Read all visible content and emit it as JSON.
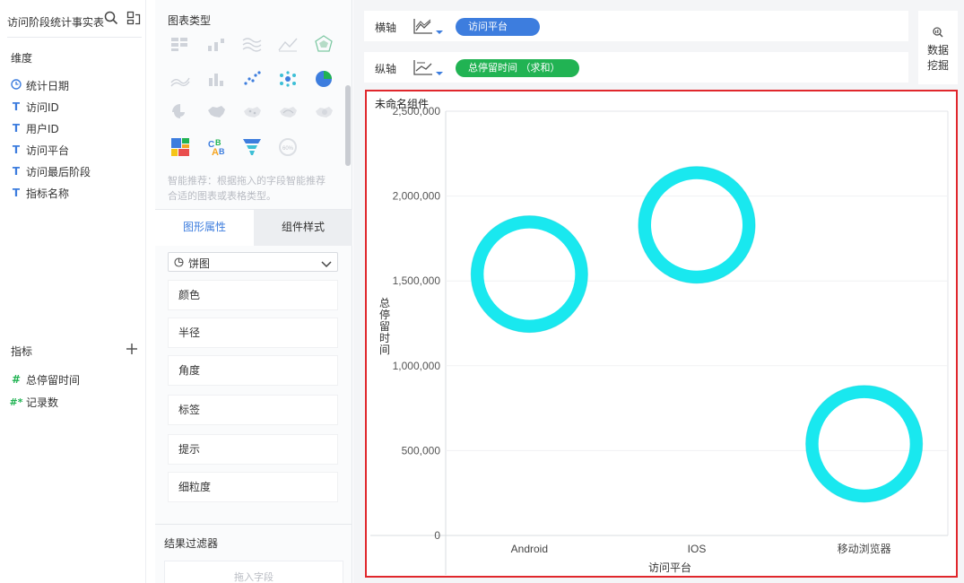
{
  "datasource": {
    "title": "访问阶段统计事实表",
    "search_icon": "search-icon",
    "switch_icon": "switch-dataset-icon"
  },
  "dimensions": {
    "label": "维度",
    "items": [
      {
        "icon": "clock-icon",
        "glyph": "◷",
        "label": "统计日期"
      },
      {
        "icon": "text-type-icon",
        "glyph": "T",
        "label": "访问ID"
      },
      {
        "icon": "text-type-icon",
        "glyph": "T",
        "label": "用户ID"
      },
      {
        "icon": "text-type-icon",
        "glyph": "T",
        "label": "访问平台"
      },
      {
        "icon": "text-type-icon",
        "glyph": "T",
        "label": "访问最后阶段"
      },
      {
        "icon": "text-type-icon",
        "glyph": "T",
        "label": "指标名称"
      }
    ]
  },
  "measures": {
    "label": "指标",
    "add_icon": "plus-icon",
    "items": [
      {
        "icon": "number-type-icon",
        "glyph": "#",
        "label": "总停留时间"
      },
      {
        "icon": "record-count-icon",
        "glyph": "#*",
        "label": "记录数"
      }
    ]
  },
  "chart_types": {
    "title": "图表类型",
    "hint": "智能推荐：根据拖入的字段智能推荐合适的图表或表格类型。"
  },
  "tabs": {
    "graph_props": "图形属性",
    "component_style": "组件样式"
  },
  "graph_type_select": {
    "value": "饼图"
  },
  "properties": [
    "颜色",
    "半径",
    "角度",
    "标签",
    "提示",
    "细粒度"
  ],
  "result_filter": {
    "title": "结果过滤器",
    "placeholder": "拖入字段"
  },
  "x_axis": {
    "label": "横轴",
    "field": "访问平台"
  },
  "y_axis": {
    "label": "纵轴",
    "field": "总停留时间 （求和）"
  },
  "data_mining": {
    "label": "数据\n挖掘",
    "icon": "data-mining-icon"
  },
  "widget": {
    "title": "未命名组件"
  },
  "colors": {
    "accent_blue": "#3d7dde",
    "accent_green": "#21b353",
    "ring": "#19e8ef",
    "highlight_border": "#e0272c"
  },
  "chart_data": {
    "type": "scatter",
    "mark": "ring",
    "categories": [
      "Android",
      "IOS",
      "移动浏览器"
    ],
    "values": [
      1540000,
      1830000,
      540000
    ],
    "xlabel": "访问平台",
    "ylabel": "总停留时间",
    "ylim": [
      0,
      2500000
    ],
    "yticks": [
      0,
      500000,
      1000000,
      1500000,
      2000000,
      2500000
    ],
    "ytick_labels": [
      "0",
      "500,000",
      "1,000,000",
      "1,500,000",
      "2,000,000",
      "2,500,000"
    ],
    "grid": true,
    "legend": "none"
  }
}
